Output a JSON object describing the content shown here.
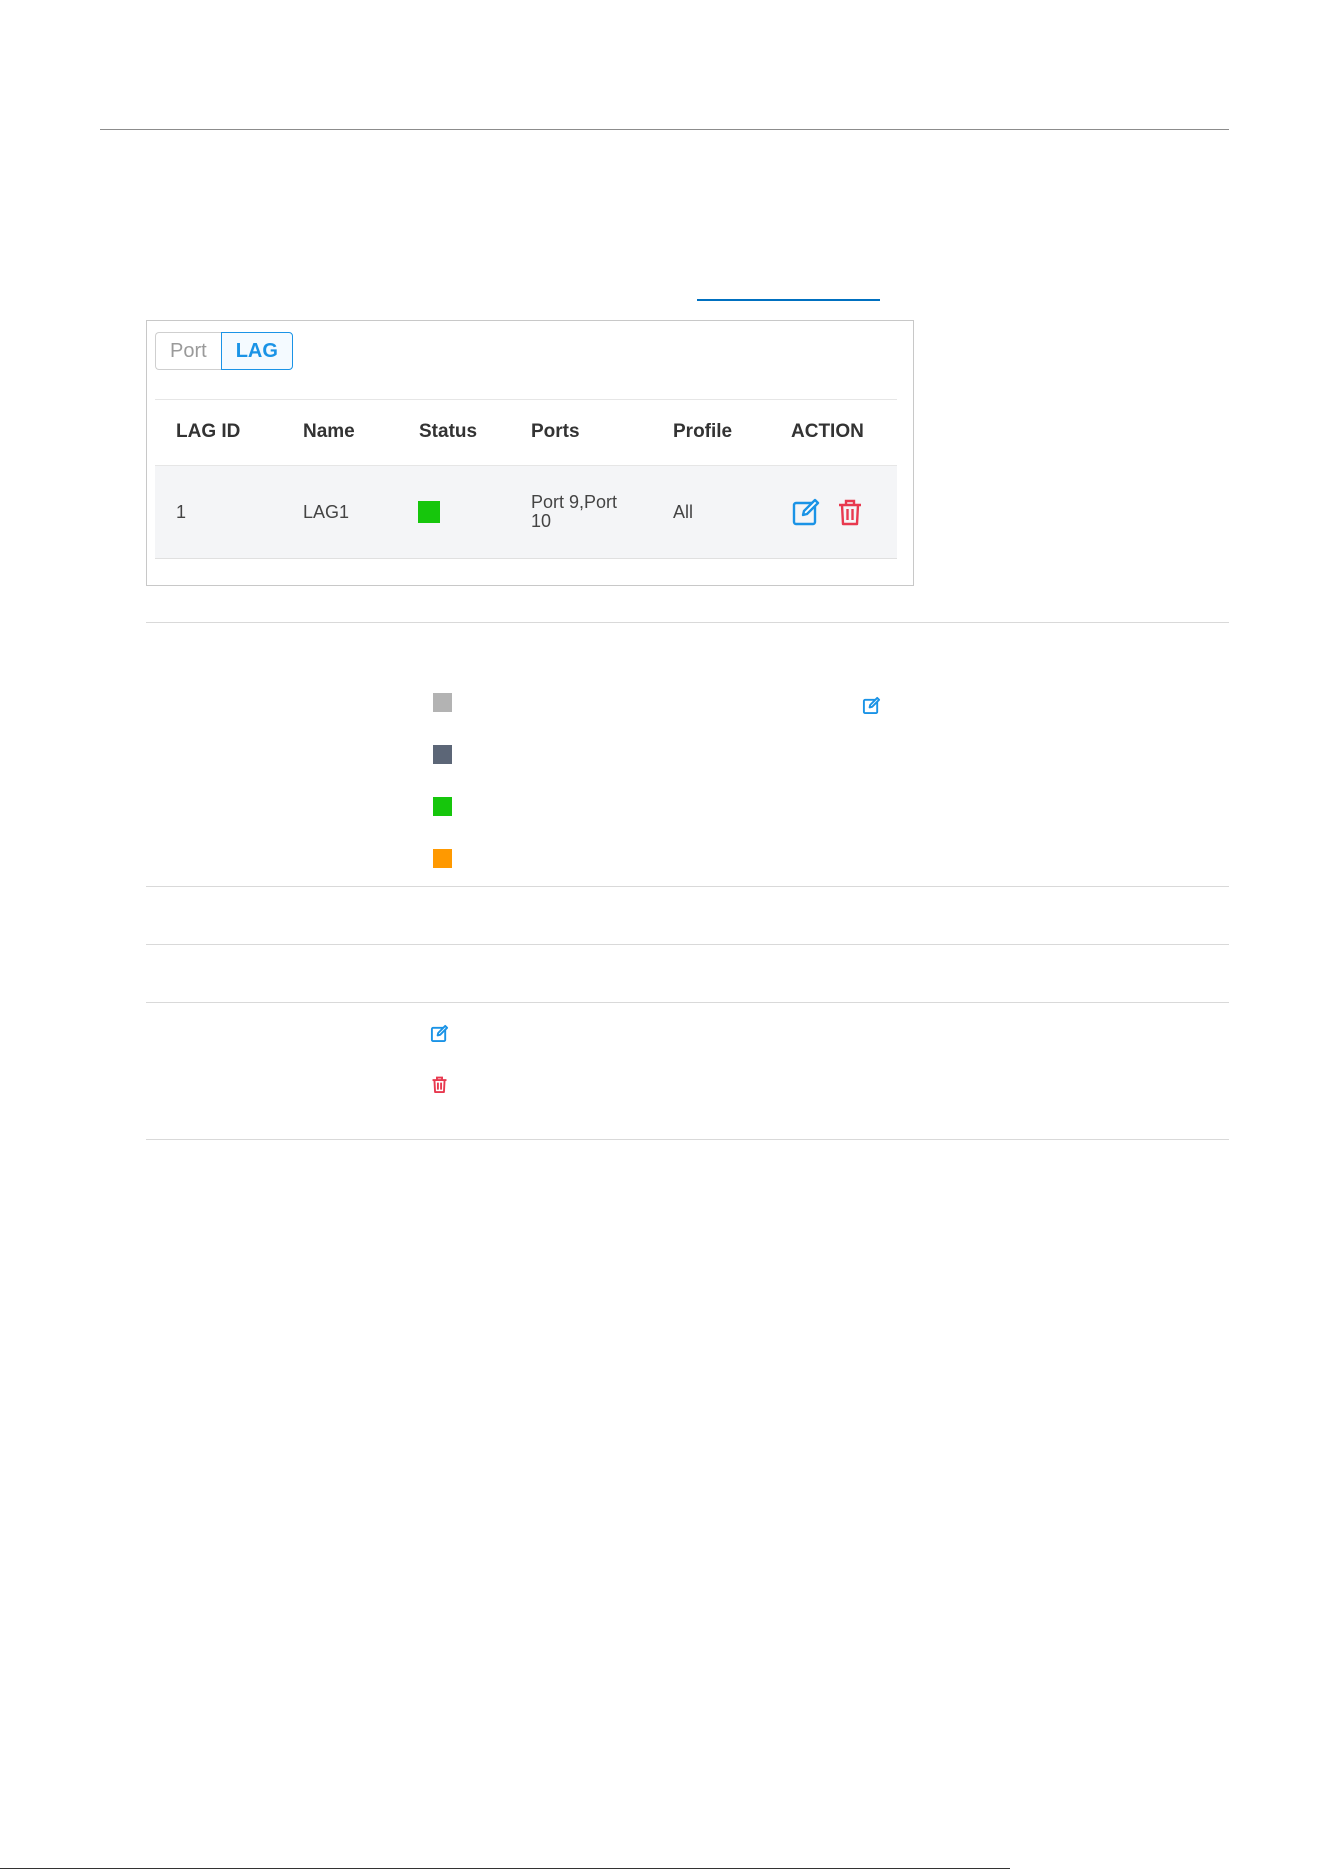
{
  "tabs": {
    "port": "Port",
    "lag": "LAG"
  },
  "table": {
    "headers": [
      "LAG ID",
      "Name",
      "Status",
      "Ports",
      "Profile",
      "ACTION"
    ],
    "rows": [
      {
        "lag_id": "1",
        "name": "LAG1",
        "status": "connected",
        "ports": "Port 9,Port 10",
        "profile": "All"
      }
    ]
  },
  "legend": {
    "colors": [
      "#b3b3b3",
      "#5c6677",
      "#16c60c",
      "#ff9900"
    ]
  },
  "colors": {
    "accent": "#1a93e6",
    "delete": "#e8394f",
    "status_green": "#16c60c"
  },
  "icons": [
    "edit-icon",
    "delete-icon"
  ]
}
